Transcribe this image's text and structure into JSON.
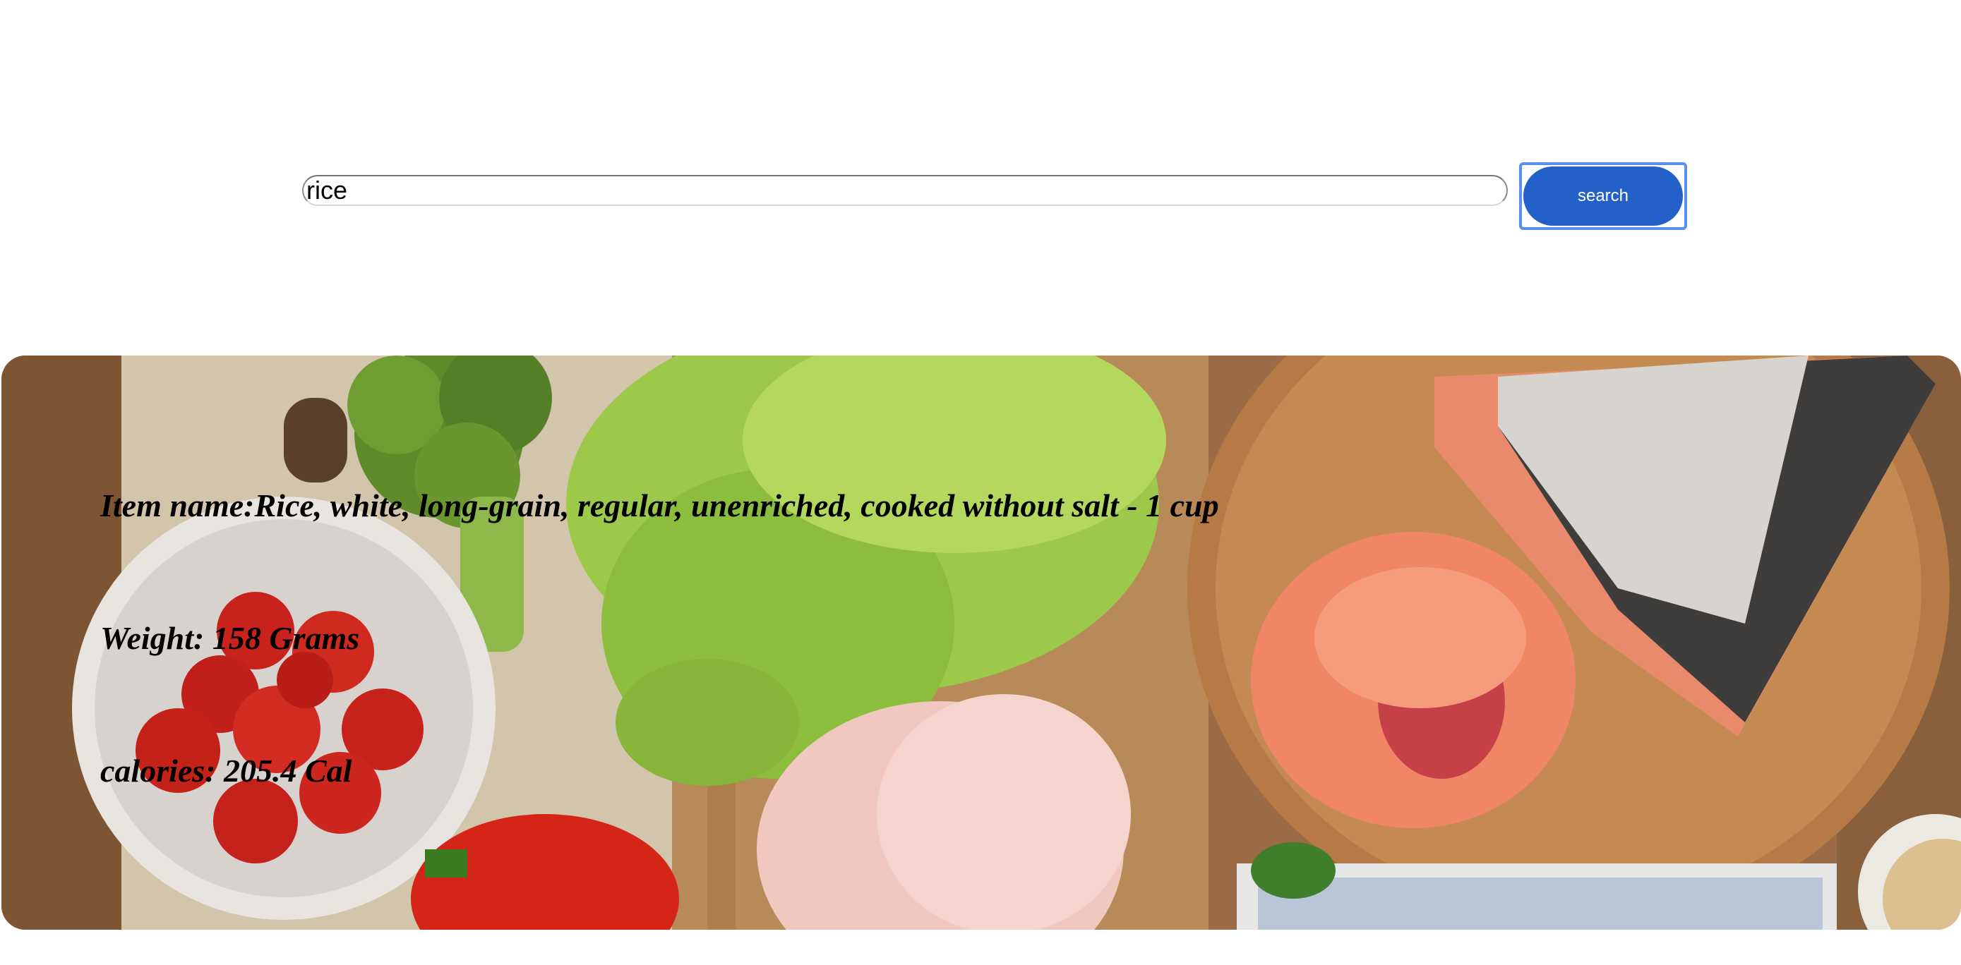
{
  "search": {
    "value": "rice",
    "button_label": "search"
  },
  "result": {
    "item_name_line": "Item name:Rice, white, long-grain, regular, unenriched, cooked without salt - 1 cup",
    "weight_line": "Weight: 158 Grams",
    "calories_line": "calories: 205.4 Cal"
  },
  "colors": {
    "button": "#2361c9",
    "focus_ring": "#5b8ef0"
  },
  "banner_image": "food-ingredients-background"
}
